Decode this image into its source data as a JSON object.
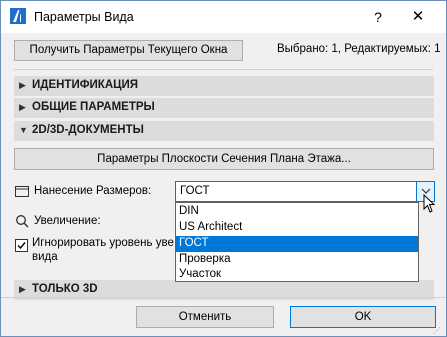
{
  "window": {
    "title": "Параметры Вида",
    "help": "?",
    "close": "✕"
  },
  "toolbar": {
    "get_params_label": "Получить Параметры Текущего Окна",
    "selection_info": "Выбрано: 1, Редактируемых: 1"
  },
  "sections": [
    {
      "label": "ИДЕНТИФИКАЦИЯ",
      "expanded": false
    },
    {
      "label": "ОБЩИЕ ПАРАМЕТРЫ",
      "expanded": false
    },
    {
      "label": "2D/3D-ДОКУМЕНТЫ",
      "expanded": true
    },
    {
      "label": "ТОЛЬКО 3D",
      "expanded": false
    }
  ],
  "docs": {
    "plane_button_label": "Параметры Плоскости Сечения Плана Этажа...",
    "dimensioning_label": "Нанесение Размеров:",
    "dimensioning_value": "ГОСТ",
    "zoom_label": "Увеличение:",
    "ignore_label_line1": "Игнорировать уровень уве",
    "ignore_label_line2": "вида",
    "ignore_checked": true
  },
  "dropdown": {
    "options": [
      "DIN",
      "US Architect",
      "ГОСТ",
      "Проверка",
      "Участок"
    ],
    "selected": "ГОСТ"
  },
  "footer": {
    "cancel_label": "Отменить",
    "ok_label": "OK"
  },
  "colors": {
    "accent": "#0078d7",
    "section_bg": "#dcdcdc",
    "dialog_bg": "#f0f0f0"
  }
}
